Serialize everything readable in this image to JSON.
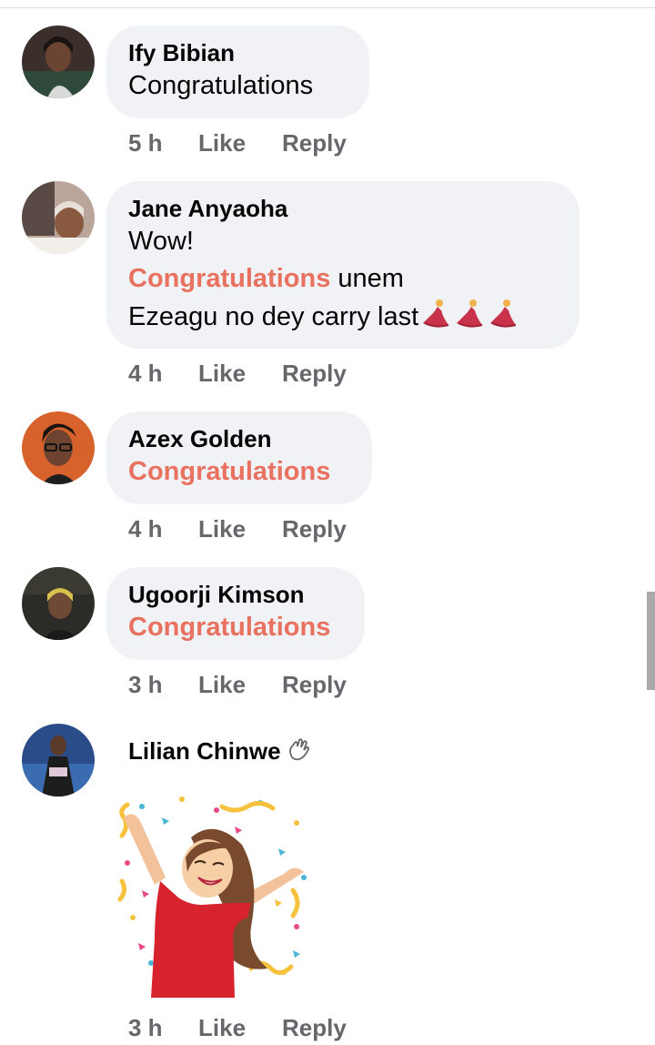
{
  "comments": [
    {
      "name": "Ify Bibian",
      "time": "5 h",
      "like": "Like",
      "reply": "Reply",
      "text": "Congratulations",
      "avatar": "ify-avatar"
    },
    {
      "name": "Jane Anyaoha",
      "time": "4 h",
      "like": "Like",
      "reply": "Reply",
      "line1": "Wow!",
      "line2_highlight": "Congratulations",
      "line2_rest": " unem",
      "line3": "Ezeagu no dey carry last",
      "emoji": "dancer-icon",
      "avatar": "jane-avatar"
    },
    {
      "name": "Azex Golden",
      "time": "4 h",
      "like": "Like",
      "reply": "Reply",
      "text": "Congratulations",
      "avatar": "azex-avatar"
    },
    {
      "name": "Ugoorji Kimson",
      "time": "3 h",
      "like": "Like",
      "reply": "Reply",
      "text": "Congratulations",
      "avatar": "ugoorji-avatar"
    },
    {
      "name": "Lilian Chinwe",
      "time": "3 h",
      "like": "Like",
      "reply": "Reply",
      "name_icon": "wave-icon",
      "sticker": "celebration-sticker",
      "avatar": "lilian-avatar"
    }
  ],
  "colors": {
    "highlight": "#e9715f",
    "bubble": "#f0f2f5",
    "meta": "#65676b"
  }
}
